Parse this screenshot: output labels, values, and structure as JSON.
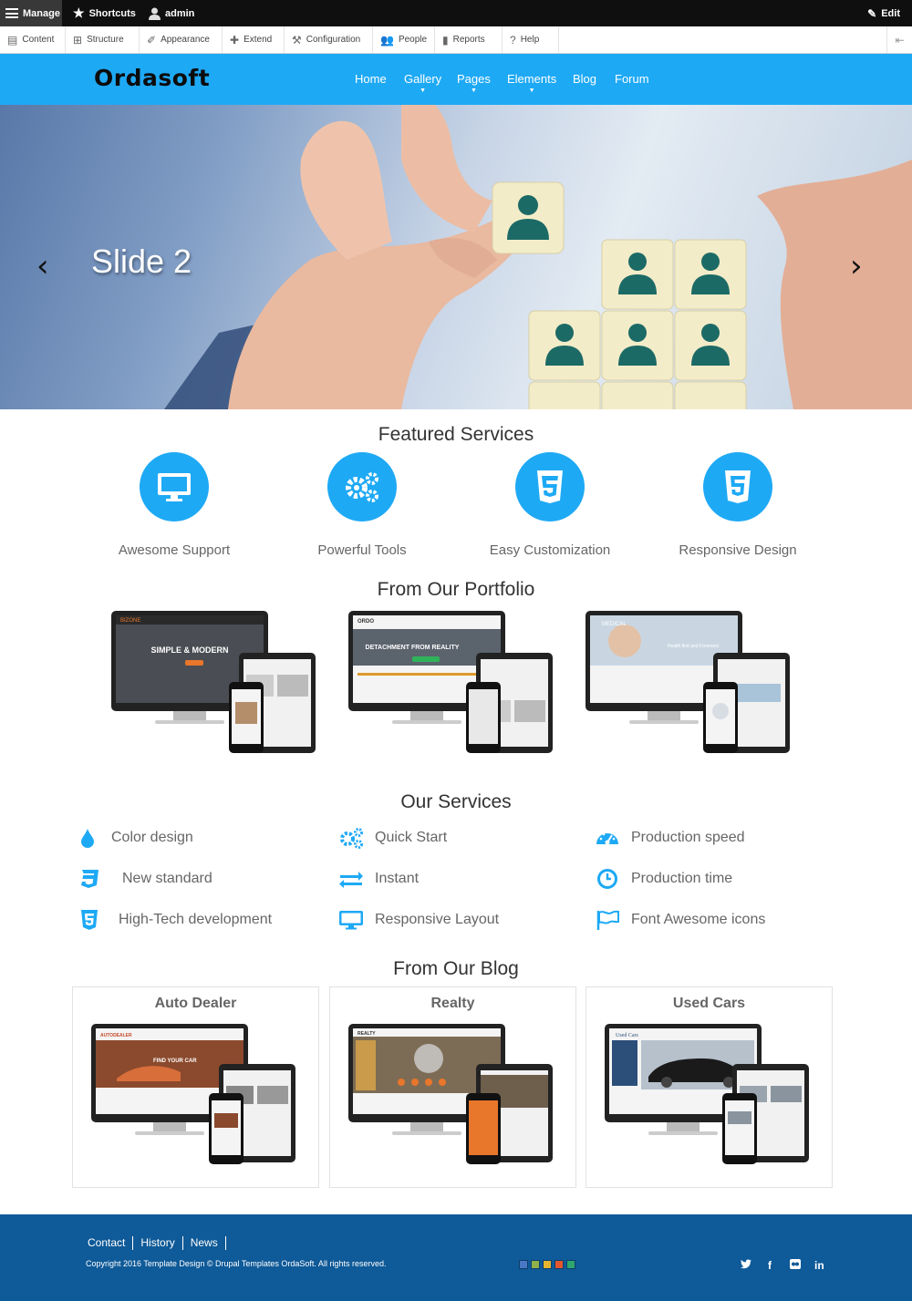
{
  "admin_bar": {
    "manage": "Manage",
    "shortcuts": "Shortcuts",
    "user": "admin",
    "edit": "Edit"
  },
  "admin_tray": {
    "items": [
      {
        "label": "Content",
        "icon": "file-icon"
      },
      {
        "label": "Structure",
        "icon": "structure-icon"
      },
      {
        "label": "Appearance",
        "icon": "brush-icon"
      },
      {
        "label": "Extend",
        "icon": "puzzle-icon"
      },
      {
        "label": "Configuration",
        "icon": "wrench-icon"
      },
      {
        "label": "People",
        "icon": "people-icon"
      },
      {
        "label": "Reports",
        "icon": "bar-chart-icon"
      },
      {
        "label": "Help",
        "icon": "help-icon"
      }
    ]
  },
  "header": {
    "logo": "Ordasoft",
    "nav": [
      {
        "label": "Home",
        "dropdown": false
      },
      {
        "label": "Gallery",
        "dropdown": true
      },
      {
        "label": "Pages",
        "dropdown": true
      },
      {
        "label": "Elements",
        "dropdown": true
      },
      {
        "label": "Blog",
        "dropdown": false
      },
      {
        "label": "Forum",
        "dropdown": false
      }
    ]
  },
  "hero": {
    "title": "Slide 2",
    "prev": "‹",
    "next": "›"
  },
  "featured": {
    "title": "Featured Services",
    "items": [
      {
        "label": "Awesome Support",
        "icon": "desktop-icon"
      },
      {
        "label": "Powerful Tools",
        "icon": "gears-icon"
      },
      {
        "label": "Easy Customization",
        "icon": "css3-icon"
      },
      {
        "label": "Responsive Design",
        "icon": "html5-icon"
      }
    ]
  },
  "portfolio": {
    "title": "From Our Portfolio",
    "items": [
      {
        "caption": "SIMPLE & MODERN",
        "brand": "BIZONE",
        "accent": "#e8762b"
      },
      {
        "caption": "DETACHMENT FROM REALITY",
        "brand": "ORDO",
        "accent": "#2fb35a"
      },
      {
        "caption": "Health first and Foremost",
        "brand": "MEDICAL",
        "accent": "#3aa6e0"
      }
    ]
  },
  "services": {
    "title": "Our Services",
    "items": [
      {
        "label": "Color design",
        "icon": "tint-icon"
      },
      {
        "label": "Quick Start",
        "icon": "gears-icon"
      },
      {
        "label": "Production speed",
        "icon": "dashboard-icon"
      },
      {
        "label": "New standard",
        "icon": "css3-icon"
      },
      {
        "label": "Instant",
        "icon": "exchange-icon"
      },
      {
        "label": "Production time",
        "icon": "clock-icon"
      },
      {
        "label": "High-Tech development",
        "icon": "html5-icon"
      },
      {
        "label": "Responsive Layout",
        "icon": "desktop-icon"
      },
      {
        "label": "Font Awesome icons",
        "icon": "flag-icon"
      }
    ]
  },
  "blog": {
    "title": "From Our Blog",
    "items": [
      {
        "label": "Auto Dealer",
        "brand": "AUTODEALER",
        "caption": "FIND YOUR CAR",
        "accent": "#c74b2a"
      },
      {
        "label": "Realty",
        "brand": "REALTY",
        "caption": "",
        "accent": "#e8762b"
      },
      {
        "label": "Used Cars",
        "brand": "Used Cars",
        "caption": "",
        "accent": "#2c4f7a"
      }
    ]
  },
  "footer": {
    "links": [
      "Contact",
      "History",
      "News"
    ],
    "copyright": "Copyright 2016 Template Design © Drupal Templates OrdaSoft. All rights reserved.",
    "swatches": [
      "#4a78c4",
      "#8fb04a",
      "#e5b531",
      "#e4572e",
      "#2fa66e"
    ],
    "social": [
      {
        "label": "🐦",
        "icon": "twitter-icon"
      },
      {
        "label": "f",
        "icon": "facebook-icon"
      },
      {
        "label": "••",
        "icon": "flickr-icon"
      },
      {
        "label": "in",
        "icon": "linkedin-icon"
      }
    ]
  },
  "colors": {
    "accent": "#1ea9f5",
    "footer": "#0f5a98",
    "admin_bar": "#0f0f0f"
  }
}
